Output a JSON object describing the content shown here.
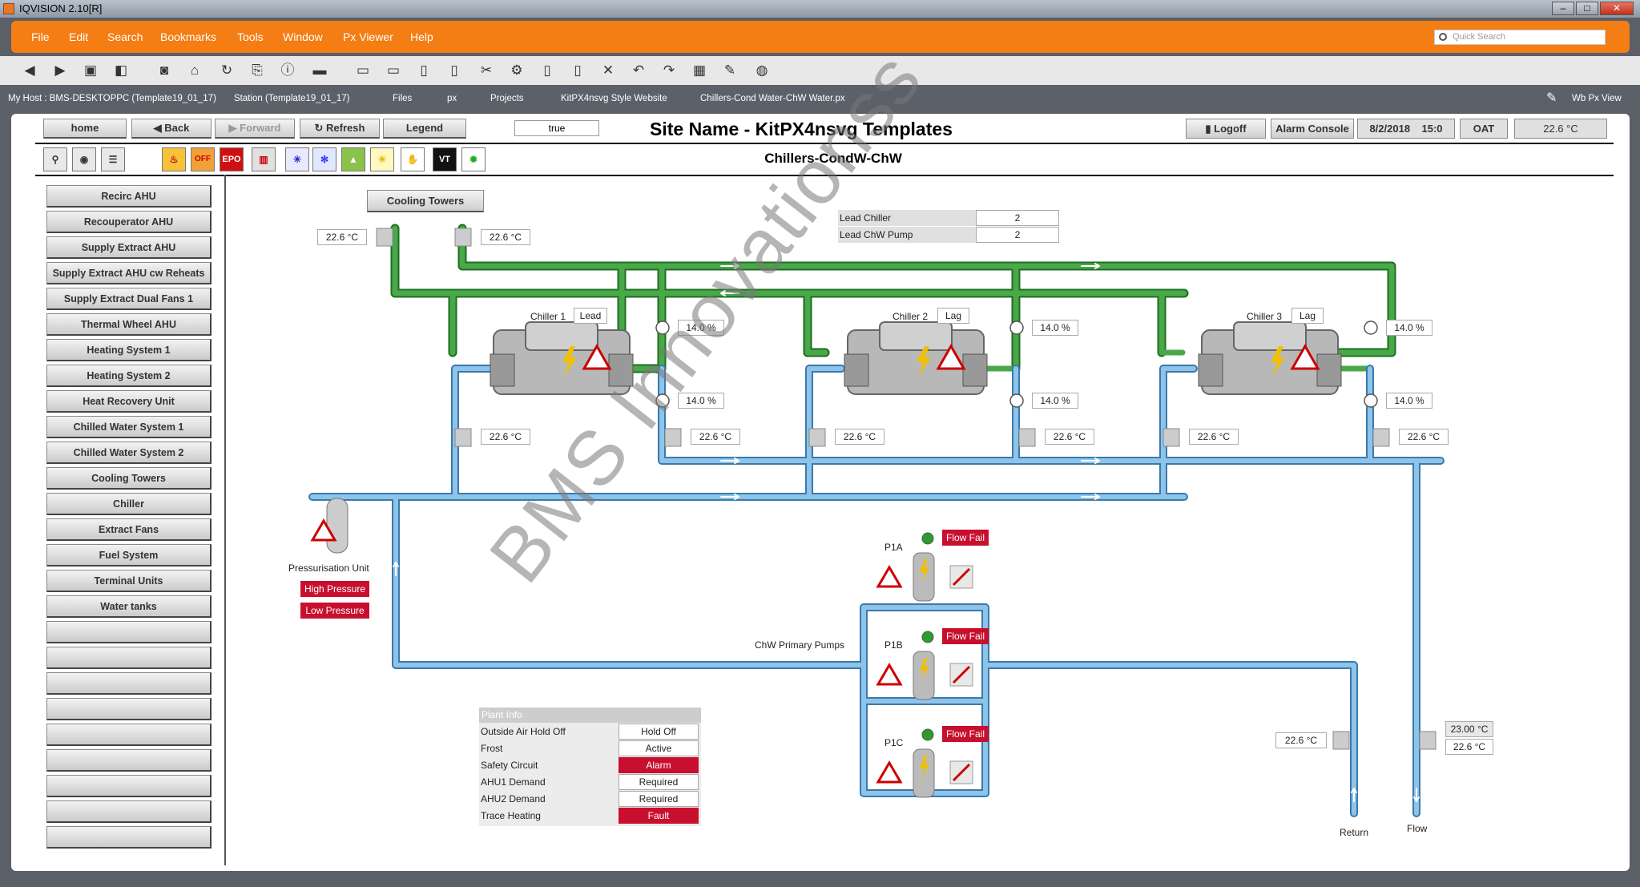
{
  "window": {
    "title": "IQVISION 2.10[R]"
  },
  "menu": [
    "File",
    "Edit",
    "Search",
    "Bookmarks",
    "Tools",
    "Window",
    "Px Viewer",
    "Help"
  ],
  "quick_search": {
    "placeholder": "Quick Search"
  },
  "path": {
    "host": "My Host : BMS-DESKTOPPC (Template19_01_17)",
    "station": "Station (Template19_01_17)",
    "files": "Files",
    "px": "px",
    "projects": "Projects",
    "website": "KitPX4nsvg Style Website",
    "page": "Chillers-Cond Water-ChW Water.px",
    "view": "Wb Px View"
  },
  "nav": {
    "home": "home",
    "back": "Back",
    "forward": "Forward",
    "refresh": "Refresh",
    "legend": "Legend",
    "true_value": "true"
  },
  "header": {
    "site_name": "Site Name - KitPX4nsvg Templates",
    "subtitle": "Chillers-CondW-ChW",
    "logoff": "Logoff",
    "alarm_console": "Alarm Console",
    "date": "8/2/2018",
    "time": "15:0",
    "oat_label": "OAT",
    "oat_value": "22.6 °C"
  },
  "icons": {
    "epo": "EPO",
    "off": "OFF",
    "vt": "VT"
  },
  "sidebar": [
    "Recirc AHU",
    "Recouperator AHU",
    "Supply Extract AHU",
    "Supply Extract AHU cw Reheats",
    "Supply Extract Dual Fans 1",
    "Thermal Wheel AHU",
    "Heating System 1",
    "Heating System 2",
    "Heat Recovery Unit",
    "Chilled Water System 1",
    "Chilled Water System 2",
    "Cooling Towers",
    "Chiller",
    "Extract Fans",
    "Fuel System",
    "Terminal Units",
    "Water tanks",
    "",
    "",
    "",
    "",
    "",
    "",
    "",
    "",
    ""
  ],
  "diagram": {
    "cooling_towers_btn": "Cooling Towers",
    "tower_temp_left": "22.6 °C",
    "tower_temp_right": "22.6 °C",
    "lead_chiller_label": "Lead Chiller",
    "lead_chiller_value": "2",
    "lead_pump_label": "Lead ChW Pump",
    "lead_pump_value": "2",
    "chillers": [
      {
        "name": "Chiller 1",
        "role": "Lead",
        "cond_valve": "14.0 %",
        "evap_valve": "14.0 %",
        "evap_in_temp": "22.6 °C",
        "evap_out_temp": "22.6 °C"
      },
      {
        "name": "Chiller 2",
        "role": "Lag",
        "cond_valve": "14.0 %",
        "evap_valve": "14.0 %",
        "evap_in_temp": "22.6 °C",
        "evap_out_temp": "22.6 °C"
      },
      {
        "name": "Chiller 3",
        "role": "Lag",
        "cond_valve": "14.0 %",
        "evap_valve": "14.0 %",
        "evap_in_temp": "22.6 °C",
        "evap_out_temp": "22.6 °C"
      }
    ],
    "pressurisation_label": "Pressurisation Unit",
    "high_pressure": "High Pressure",
    "low_pressure": "Low Pressure",
    "pumps_label": "ChW Primary Pumps",
    "pumps": [
      {
        "name": "P1A",
        "status": "Flow Fail"
      },
      {
        "name": "P1B",
        "status": "Flow Fail"
      },
      {
        "name": "P1C",
        "status": "Flow Fail"
      }
    ],
    "return_label": "Return",
    "flow_label": "Flow",
    "return_temp": "22.6 °C",
    "flow_setpoint": "23.00 °C",
    "flow_temp": "22.6 °C"
  },
  "plant_info": {
    "title": "Plant Info",
    "rows": [
      {
        "label": "Outside Air Hold Off",
        "value": "Hold Off",
        "alarm": false
      },
      {
        "label": "Frost",
        "value": "Active",
        "alarm": false
      },
      {
        "label": "Safety Circuit",
        "value": "Alarm",
        "alarm": true
      },
      {
        "label": "AHU1 Demand",
        "value": "Required",
        "alarm": false
      },
      {
        "label": "AHU2 Demand",
        "value": "Required",
        "alarm": false
      },
      {
        "label": "Trace Heating",
        "value": "Fault",
        "alarm": true
      }
    ]
  },
  "watermark": "BMS Innovationss",
  "colors": {
    "condenser_pipe": "#3a9b3a",
    "chw_pipe": "#7fb3dc",
    "menu": "#f47d14",
    "alarm": "#c8102e"
  }
}
